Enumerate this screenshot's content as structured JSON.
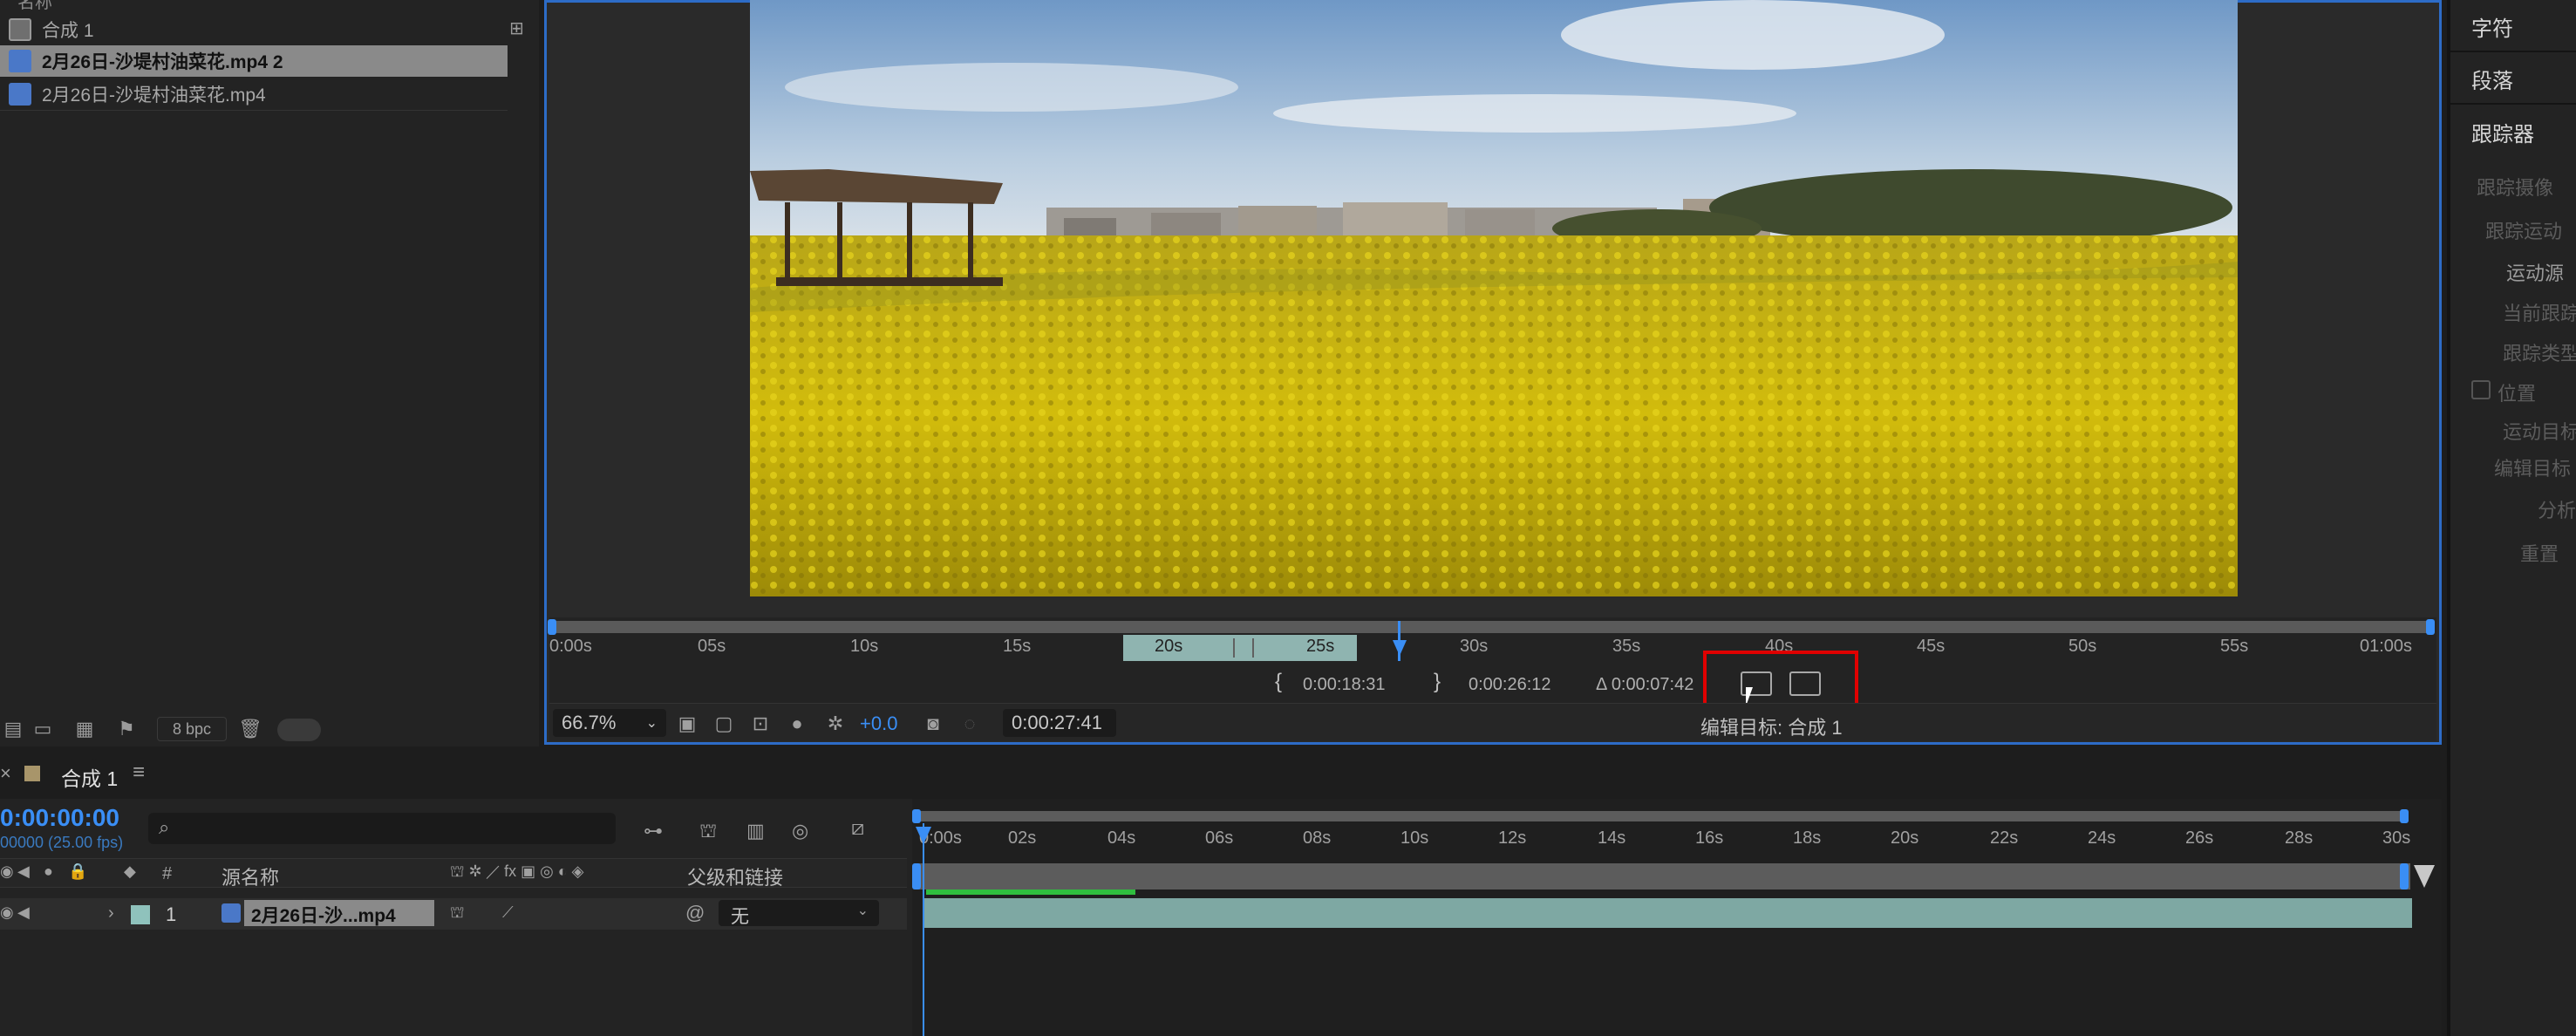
{
  "project": {
    "header_partial": "名称",
    "items": [
      {
        "name": "合成 1",
        "type": "composition"
      },
      {
        "name": "2月26日-沙堤村油菜花.mp4 2",
        "type": "footage",
        "selected": true
      },
      {
        "name": "2月26日-沙堤村油菜花.mp4",
        "type": "footage"
      }
    ],
    "footer": {
      "bpc": "8 bpc"
    }
  },
  "viewer": {
    "ruler_ticks": [
      "0:00s",
      "05s",
      "10s",
      "15s",
      "20s",
      "25s",
      "30s",
      "35s",
      "40s",
      "45s",
      "50s",
      "55s",
      "01:00s"
    ],
    "in_point": "0:00:18:31",
    "out_point": "0:00:26:12",
    "duration": "Δ 0:00:07:42",
    "zoom": "66.7%",
    "exposure": "+0.0",
    "current_time": "0:00:27:41",
    "edit_target": "编辑目标: 合成 1"
  },
  "right_panel": {
    "tabs": [
      "字符",
      "段落",
      "跟踪器"
    ],
    "tracker_dimmed": [
      "跟踪摄像",
      "跟踪运动",
      "运动源",
      "当前跟踪",
      "跟踪类型",
      "位置",
      "运动目标",
      "编辑目标",
      "分析",
      "重置"
    ]
  },
  "timeline": {
    "tab_label": "合成 1",
    "timecode": "0:00:00:00",
    "fps_line": "00000 (25.00 fps)",
    "search_placeholder": "",
    "col_number": "#",
    "col_source": "源名称",
    "col_parent": "父级和链接",
    "layer": {
      "index": "1",
      "name": "2月26日-沙...mp4",
      "parent": "无"
    },
    "ruler_ticks": [
      "0:00s",
      "02s",
      "04s",
      "06s",
      "08s",
      "10s",
      "12s",
      "14s",
      "16s",
      "18s",
      "20s",
      "22s",
      "24s",
      "26s",
      "28s",
      "30s"
    ]
  },
  "colors": {
    "accent": "#2d6cc7",
    "highlight_box": "#e00000",
    "clip": "#7ea8a3",
    "work_area": "#8fb4b0"
  }
}
